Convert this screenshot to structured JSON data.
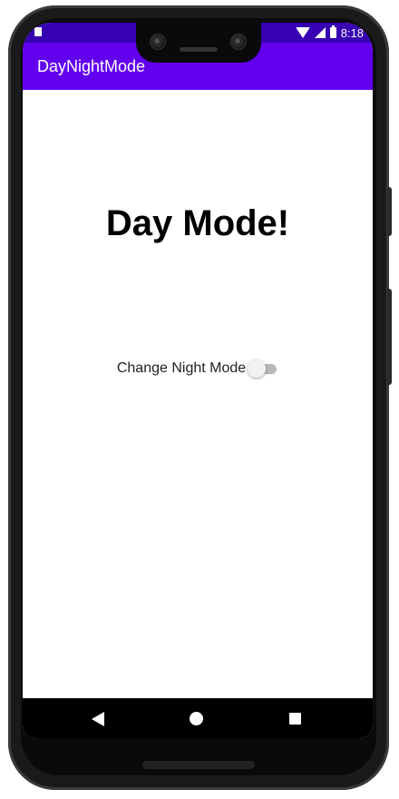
{
  "status_bar": {
    "time": "8:18",
    "color": "#3700b3",
    "icons": [
      "sim-card-icon",
      "wifi-icon",
      "signal-icon",
      "battery-charging-icon"
    ]
  },
  "app_bar": {
    "title": "DayNightMode",
    "color": "#6200ee"
  },
  "main": {
    "headline": "Day Mode!",
    "night_mode_toggle": {
      "label": "Change Night Mode",
      "checked": false
    }
  },
  "navigation_bar": {
    "buttons": [
      "back-icon",
      "home-icon",
      "recents-icon"
    ]
  }
}
